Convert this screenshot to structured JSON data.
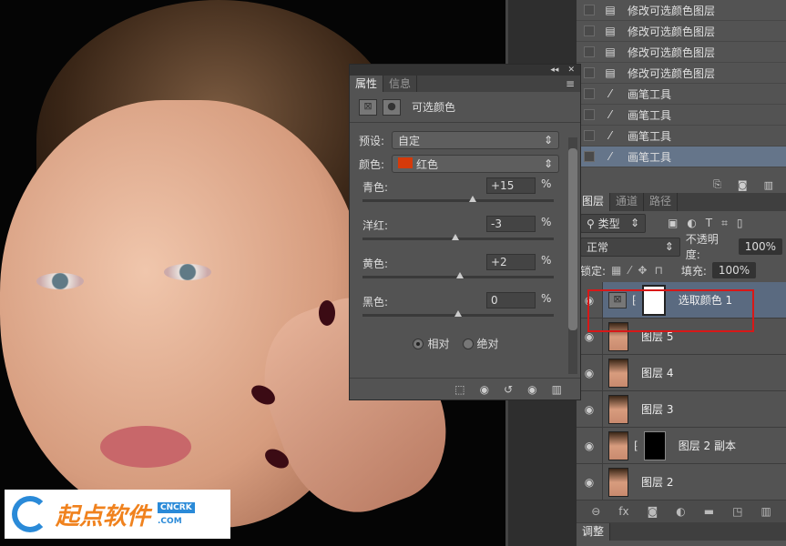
{
  "history": {
    "items": [
      {
        "label": "修改可选颜色图层",
        "icon": "doc-icon"
      },
      {
        "label": "修改可选颜色图层",
        "icon": "doc-icon"
      },
      {
        "label": "修改可选颜色图层",
        "icon": "doc-icon"
      },
      {
        "label": "修改可选颜色图层",
        "icon": "doc-icon"
      },
      {
        "label": "画笔工具",
        "icon": "brush-icon"
      },
      {
        "label": "画笔工具",
        "icon": "brush-icon"
      },
      {
        "label": "画笔工具",
        "icon": "brush-icon"
      },
      {
        "label": "画笔工具",
        "icon": "brush-icon",
        "selected": true
      }
    ]
  },
  "layers": {
    "tabs": [
      "图层",
      "通道",
      "路径"
    ],
    "filter": "类型",
    "blend_mode": "正常",
    "opacity_label": "不透明度:",
    "opacity": "100%",
    "lock_label": "锁定:",
    "fill_label": "填充:",
    "fill": "100%",
    "items": [
      {
        "name": "选取颜色 1",
        "type": "adjustment",
        "active": true
      },
      {
        "name": "图层 5"
      },
      {
        "name": "图层 4"
      },
      {
        "name": "图层 3"
      },
      {
        "name": "图层 2 副本",
        "mask": true
      },
      {
        "name": "图层 2"
      }
    ],
    "adjust_tab": "调整"
  },
  "properties": {
    "tabs": [
      "属性",
      "信息"
    ],
    "title": "可选颜色",
    "preset_label": "预设:",
    "preset": "自定",
    "color_label": "颜色:",
    "color": "红色",
    "color_swatch": "#d63a0a",
    "sliders": [
      {
        "label": "青色:",
        "value": "+15",
        "unit": "%",
        "num": 15
      },
      {
        "label": "洋红:",
        "value": "-3",
        "unit": "%",
        "num": -3
      },
      {
        "label": "黄色:",
        "value": "+2",
        "unit": "%",
        "num": 2
      },
      {
        "label": "黑色:",
        "value": "0",
        "unit": "%",
        "num": 0
      }
    ],
    "relative": "相对",
    "absolute": "绝对"
  },
  "watermark": {
    "name": "起点软件",
    "site1": "CNCRK",
    "site2": ".COM"
  }
}
